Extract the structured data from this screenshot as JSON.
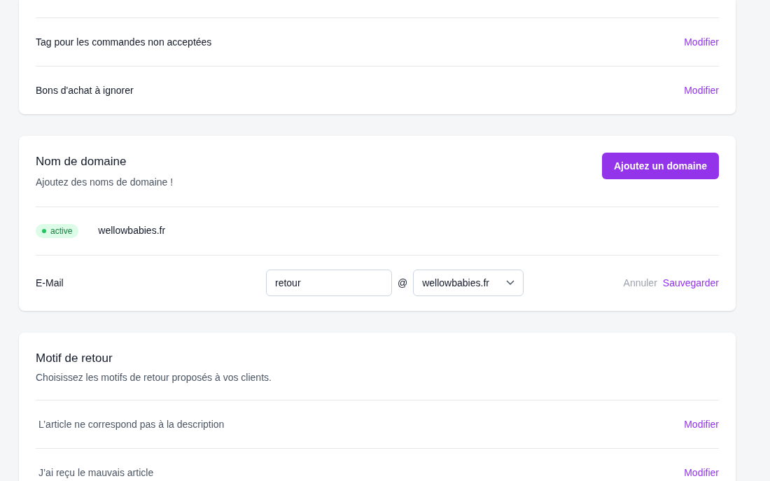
{
  "settings_card": {
    "rows": [
      {
        "label": "Tag pour les commandes non acceptées",
        "action": "Modifier"
      },
      {
        "label": "Bons d'achat à ignorer",
        "action": "Modifier"
      }
    ]
  },
  "domain_card": {
    "title": "Nom de domaine",
    "subtitle": "Ajoutez des noms de domaine !",
    "button": "Ajoutez un domaine",
    "domains": [
      {
        "status": "active",
        "color": "#22c55e",
        "name": "wellowbabies.fr"
      }
    ],
    "email": {
      "label": "E-Mail",
      "local_part": "retour",
      "at": "@",
      "domain": "wellowbabies.fr",
      "cancel": "Annuler",
      "save": "Sauvegarder"
    }
  },
  "reasons_card": {
    "title": "Motif de retour",
    "subtitle": "Choisissez les motifs de retour proposés à vos clients.",
    "rows": [
      {
        "label": "L’article ne correspond pas à la description",
        "action": "Modifier"
      },
      {
        "label": "J’ai reçu le mauvais article",
        "action": "Modifier"
      }
    ]
  }
}
